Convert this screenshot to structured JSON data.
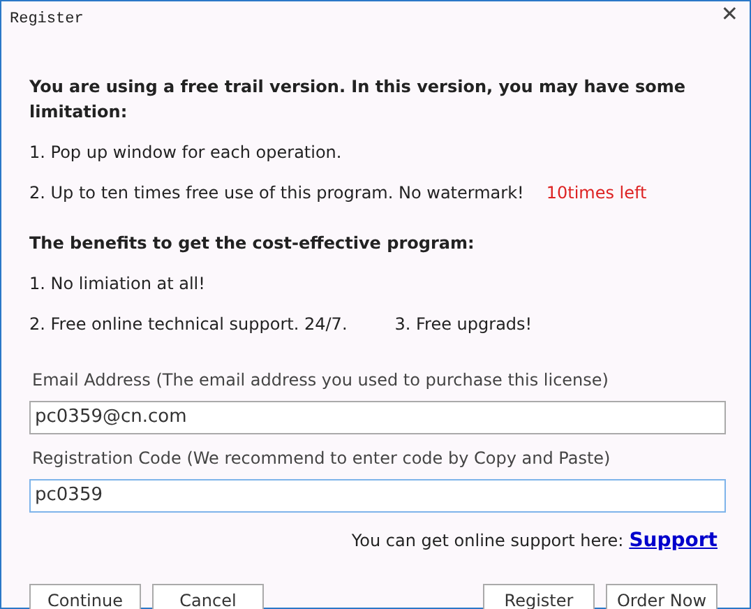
{
  "window": {
    "title": "Register",
    "close": "✕"
  },
  "intro": "You are using a free trail version. In this version, you may have some limitation:",
  "limitations": [
    {
      "text": "1. Pop up window for each operation."
    },
    {
      "text": "2. Up to ten times free use of this program. No watermark!",
      "note": "10times left"
    }
  ],
  "benefits_heading": "The benefits to get the cost-effective program:",
  "benefits": [
    {
      "texts": [
        "1. No limiation at all!"
      ]
    },
    {
      "texts": [
        "2. Free online technical support. 24/7.",
        "3. Free upgrads!"
      ]
    }
  ],
  "email": {
    "label": "Email Address (The email address you used to purchase this license)",
    "value": "pc0359@cn.com"
  },
  "code": {
    "label": "Registration Code (We recommend to enter code by Copy and Paste)",
    "value": "pc0359"
  },
  "support": {
    "text": "You can get online support here:",
    "link": "Support"
  },
  "buttons_left": [
    "Continue",
    "Cancel"
  ],
  "buttons_right": [
    "Register",
    "Order Now"
  ]
}
